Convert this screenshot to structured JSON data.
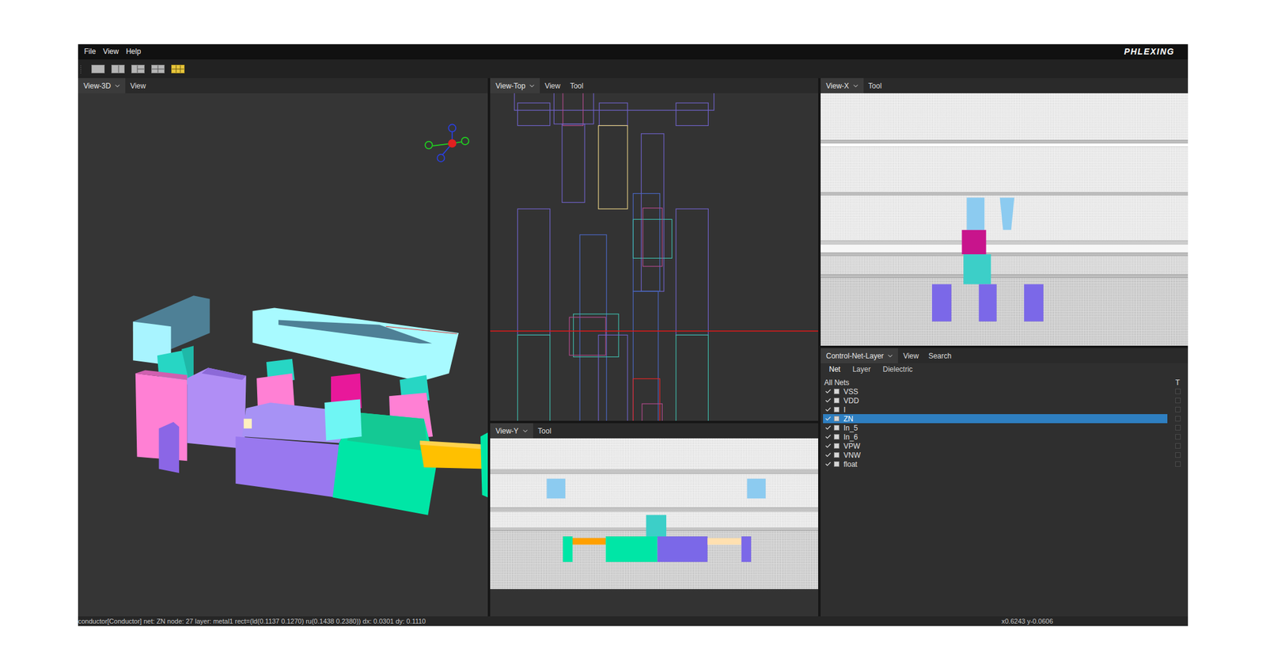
{
  "window": {
    "menu": [
      "File",
      "View",
      "Help"
    ],
    "logo": "PHLEXING"
  },
  "toolbar": {
    "layouts": [
      {
        "selected": false
      },
      {
        "selected": false
      },
      {
        "selected": false
      },
      {
        "selected": false
      },
      {
        "selected": true
      }
    ]
  },
  "panels": {
    "view3d": {
      "title": "View-3D",
      "menus": [
        "View"
      ]
    },
    "viewTop": {
      "title": "View-Top",
      "menus": [
        "View",
        "Tool"
      ]
    },
    "viewY": {
      "title": "View-Y",
      "menus": [
        "Tool"
      ]
    },
    "viewX": {
      "title": "View-X",
      "menus": [
        "Tool"
      ]
    },
    "control": {
      "title": "Control-Net-Layer",
      "menus": [
        "View",
        "Search"
      ],
      "tabs": [
        {
          "label": "Net",
          "selected": true
        },
        {
          "label": "Layer",
          "selected": false
        },
        {
          "label": "Dielectric",
          "selected": false
        }
      ],
      "list_header": "All Nets",
      "column_t": "T",
      "nets": [
        {
          "name": "VSS",
          "checked": true,
          "selected": false,
          "t": false
        },
        {
          "name": "VDD",
          "checked": true,
          "selected": false,
          "t": false
        },
        {
          "name": "I",
          "checked": true,
          "selected": false,
          "t": false
        },
        {
          "name": "ZN",
          "checked": true,
          "selected": true,
          "t": false
        },
        {
          "name": "In_5",
          "checked": true,
          "selected": false,
          "t": false
        },
        {
          "name": "In_6",
          "checked": true,
          "selected": false,
          "t": false
        },
        {
          "name": "VPW",
          "checked": true,
          "selected": false,
          "t": false
        },
        {
          "name": "VNW",
          "checked": true,
          "selected": false,
          "t": false
        },
        {
          "name": "float",
          "checked": true,
          "selected": false,
          "t": false
        }
      ]
    }
  },
  "status_bar": {
    "info": "conductor[Conductor] net: ZN node: 27 layer: metal1 rect=(ld(0.1137 0.1270)  ru(0.1438 0.2380)) dx: 0.0301 dy: 0.1110",
    "coords": "x0.6243 y-0.0606"
  }
}
